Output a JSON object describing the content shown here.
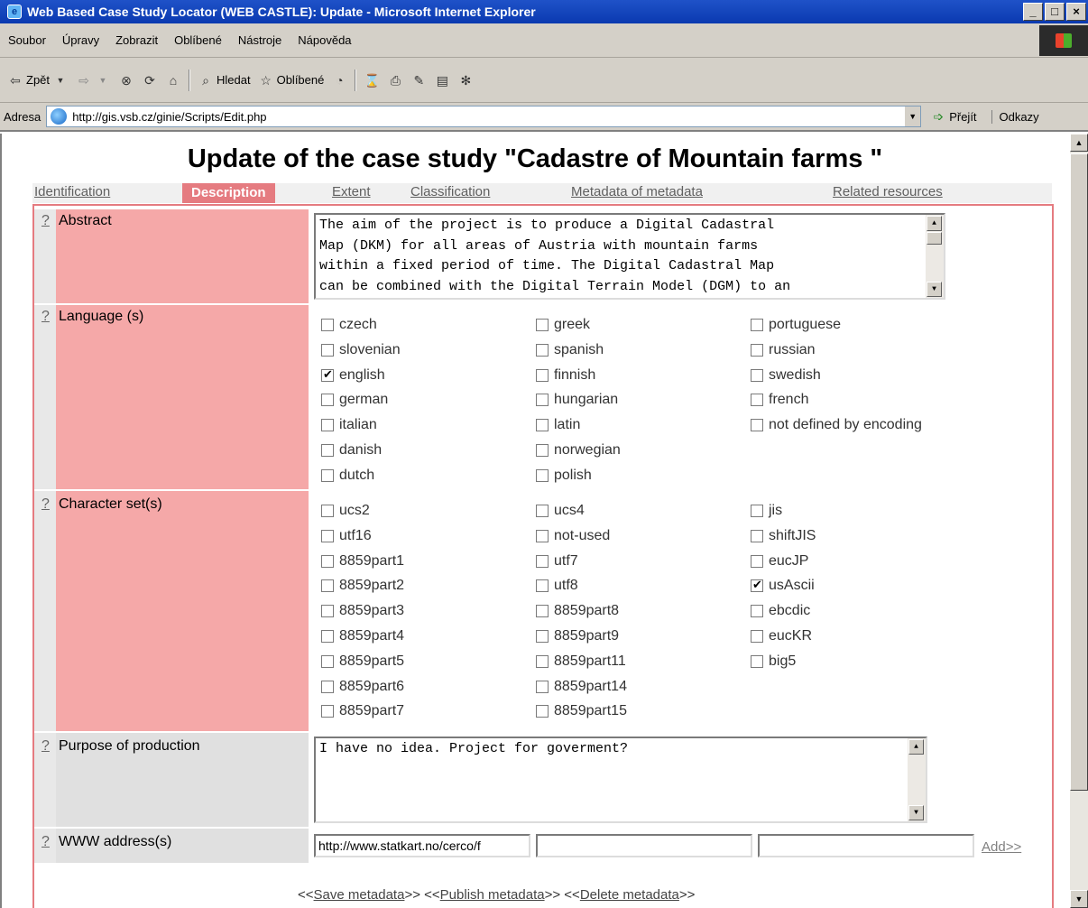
{
  "window": {
    "title": "Web Based Case Study Locator (WEB CASTLE): Update - Microsoft Internet Explorer",
    "controls": [
      "_",
      "□",
      "×"
    ]
  },
  "menu": [
    "Soubor",
    "Úpravy",
    "Zobrazit",
    "Oblíbené",
    "Nástroje",
    "Nápověda"
  ],
  "toolbar": {
    "back": "Zpět",
    "search": "Hledat",
    "favorites": "Oblíbené"
  },
  "address": {
    "label": "Adresa",
    "url": "http://gis.vsb.cz/ginie/Scripts/Edit.php",
    "go": "Přejít",
    "links": "Odkazy"
  },
  "page": {
    "title": "Update of the case study \"Cadastre of Mountain farms \"",
    "tabs": [
      {
        "label": "Identification",
        "active": false
      },
      {
        "label": "Description",
        "active": true
      },
      {
        "label": "Extent",
        "active": false
      },
      {
        "label": "Classification",
        "active": false
      },
      {
        "label": "Metadata of metadata",
        "active": false
      },
      {
        "label": "Related resources",
        "active": false
      }
    ],
    "help": "?",
    "fields": {
      "abstract": {
        "label": "Abstract",
        "lines": [
          "The aim of the project is to produce a Digital Cadastral",
          "Map (DKM) for all areas of Austria with mountain farms",
          "within a fixed period of time. The Digital Cadastral Map",
          "can be combined with the Digital Terrain Model (DGM) to an"
        ]
      },
      "languages": {
        "label": "Language (s)",
        "columns": [
          [
            {
              "label": "czech",
              "checked": false
            },
            {
              "label": "slovenian",
              "checked": false
            },
            {
              "label": "english",
              "checked": true
            },
            {
              "label": "german",
              "checked": false
            },
            {
              "label": "italian",
              "checked": false
            },
            {
              "label": "danish",
              "checked": false
            },
            {
              "label": "dutch",
              "checked": false
            }
          ],
          [
            {
              "label": "greek",
              "checked": false
            },
            {
              "label": "spanish",
              "checked": false
            },
            {
              "label": "finnish",
              "checked": false
            },
            {
              "label": "hungarian",
              "checked": false
            },
            {
              "label": "latin",
              "checked": false
            },
            {
              "label": "norwegian",
              "checked": false
            },
            {
              "label": "polish",
              "checked": false
            }
          ],
          [
            {
              "label": "portuguese",
              "checked": false
            },
            {
              "label": "russian",
              "checked": false
            },
            {
              "label": "swedish",
              "checked": false
            },
            {
              "label": "french",
              "checked": false
            },
            {
              "label": "not defined by encoding",
              "checked": false
            }
          ]
        ]
      },
      "charsets": {
        "label": "Character set(s)",
        "columns": [
          [
            {
              "label": "ucs2",
              "checked": false
            },
            {
              "label": "utf16",
              "checked": false
            },
            {
              "label": "8859part1",
              "checked": false
            },
            {
              "label": "8859part2",
              "checked": false
            },
            {
              "label": "8859part3",
              "checked": false
            },
            {
              "label": "8859part4",
              "checked": false
            },
            {
              "label": "8859part5",
              "checked": false
            },
            {
              "label": "8859part6",
              "checked": false
            },
            {
              "label": "8859part7",
              "checked": false
            }
          ],
          [
            {
              "label": "ucs4",
              "checked": false
            },
            {
              "label": "not-used",
              "checked": false
            },
            {
              "label": "utf7",
              "checked": false
            },
            {
              "label": "utf8",
              "checked": false
            },
            {
              "label": "8859part8",
              "checked": false
            },
            {
              "label": "8859part9",
              "checked": false
            },
            {
              "label": "8859part11",
              "checked": false
            },
            {
              "label": "8859part14",
              "checked": false
            },
            {
              "label": "8859part15",
              "checked": false
            }
          ],
          [
            {
              "label": "jis",
              "checked": false
            },
            {
              "label": "shiftJIS",
              "checked": false
            },
            {
              "label": "eucJP",
              "checked": false
            },
            {
              "label": "usAscii",
              "checked": true
            },
            {
              "label": "ebcdic",
              "checked": false
            },
            {
              "label": "eucKR",
              "checked": false
            },
            {
              "label": "big5",
              "checked": false
            }
          ]
        ]
      },
      "purpose": {
        "label": "Purpose of production",
        "value": "I have no idea. Project for goverment?"
      },
      "www": {
        "label": "WWW address(s)",
        "values": [
          "http://www.statkart.no/cerco/f",
          "",
          ""
        ],
        "add": "Add>>"
      }
    },
    "actions": {
      "open": "<<",
      "close": ">>",
      "save": "Save metadata",
      "publish": "Publish metadata",
      "delete": "Delete metadata"
    }
  },
  "colors": {
    "label_bg": "#f5a8a8",
    "active_tab": "#e57b80",
    "title_bar": "#0a39b0"
  }
}
